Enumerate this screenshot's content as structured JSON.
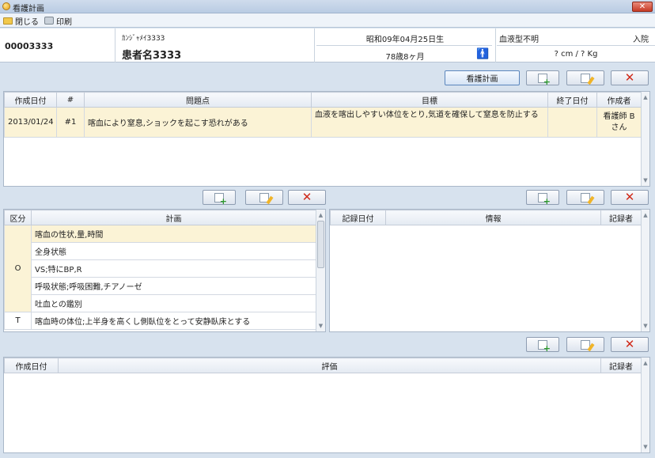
{
  "window": {
    "title": "看護計画",
    "close": "✕"
  },
  "menu": {
    "close": "閉じる",
    "print": "印刷"
  },
  "patient": {
    "id": "00003333",
    "kana": "ｶﾝｼﾞｬﾒｲ3333",
    "name": "患者名3333",
    "birth": "昭和09年04月25日生",
    "age": "78歳8ヶ月",
    "blood": "血液型不明",
    "status": "入院",
    "body": "? cm / ? Kg"
  },
  "toolbar": {
    "nursing_plan": "看護計画"
  },
  "problems": {
    "headers": [
      "作成日付",
      "#",
      "問題点",
      "目標",
      "終了日付",
      "作成者"
    ],
    "rows": [
      {
        "date": "2013/01/24",
        "num": "#1",
        "problem": "喀血により窒息,ショックを起こす恐れがある",
        "goal": "血液を喀出しやすい体位をとり,気道を確保して窒息を防止する",
        "end": "",
        "author": "看護師 B さん"
      }
    ]
  },
  "plan": {
    "headers": [
      "区分",
      "計画"
    ],
    "rows": [
      {
        "category": "",
        "text": "喀血の性状,量,時間"
      },
      {
        "category": "",
        "text": "全身状態"
      },
      {
        "category": "O",
        "text": "VS;特にBP,R"
      },
      {
        "category": "",
        "text": "呼吸状態;呼吸困難,チアノーゼ"
      },
      {
        "category": "",
        "text": "吐血との鑑別"
      },
      {
        "category": "T",
        "text": "喀血時の体位;上半身を高くし側臥位をとって安静臥床とする"
      }
    ]
  },
  "info": {
    "headers": [
      "記録日付",
      "情報",
      "記録者"
    ]
  },
  "evaluation": {
    "headers": [
      "作成日付",
      "評価",
      "記録者"
    ]
  }
}
